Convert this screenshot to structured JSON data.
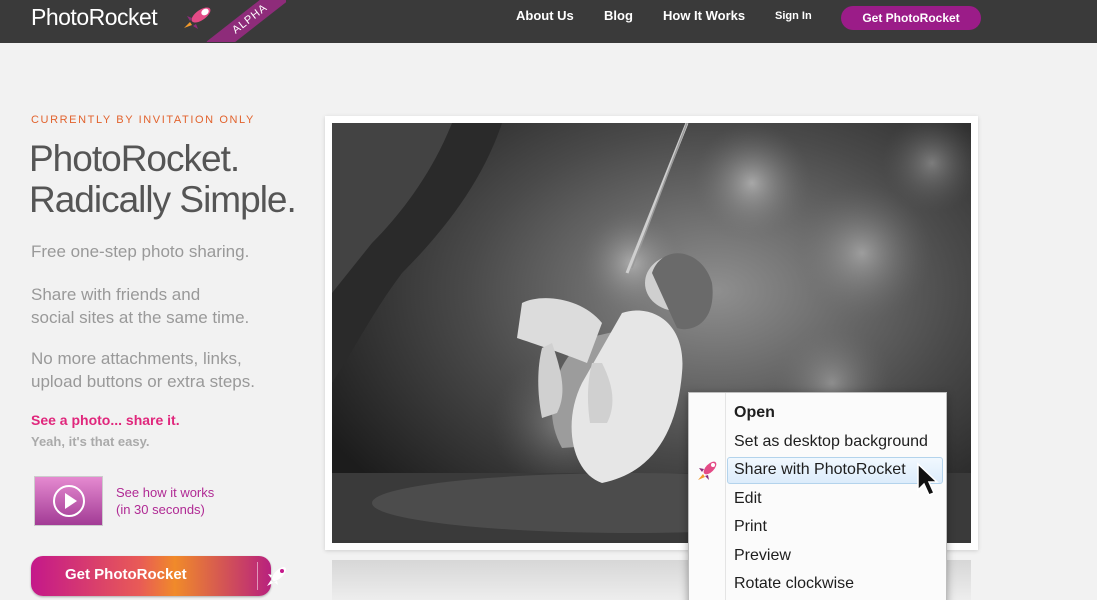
{
  "header": {
    "logo_text": "PhotoRocket",
    "alpha_badge": "ALPHA",
    "nav": [
      "About Us",
      "Blog",
      "How It Works",
      "Sign In"
    ],
    "cta": "Get PhotoRocket"
  },
  "hero": {
    "eyebrow": "CURRENTLY BY INVITATION ONLY",
    "headline_line1": "PhotoRocket.",
    "headline_line2": "Radically Simple.",
    "p1": "Free one-step photo sharing.",
    "p2_line1": "Share with friends and",
    "p2_line2": "social sites at the same time.",
    "p3_line1": "No more attachments, links,",
    "p3_line2": "upload buttons or extra steps.",
    "see_photo": "See a photo... share it.",
    "easy": "Yeah, it's that easy.",
    "video_line1": "See how it works",
    "video_line2": "(in 30 seconds)",
    "cta": "Get PhotoRocket"
  },
  "context_menu": {
    "items": [
      "Open",
      "Set as desktop background",
      "Share with PhotoRocket",
      "Edit",
      "Print",
      "Preview",
      "Rotate clockwise"
    ],
    "highlighted_index": 2
  },
  "colors": {
    "nav_bg": "#3a3a3a",
    "brand_purple": "#9b1c88",
    "eyebrow_orange": "#e2632e",
    "pink": "#e0277c"
  },
  "icons": [
    "rocket-icon",
    "play-icon",
    "cursor-icon"
  ]
}
